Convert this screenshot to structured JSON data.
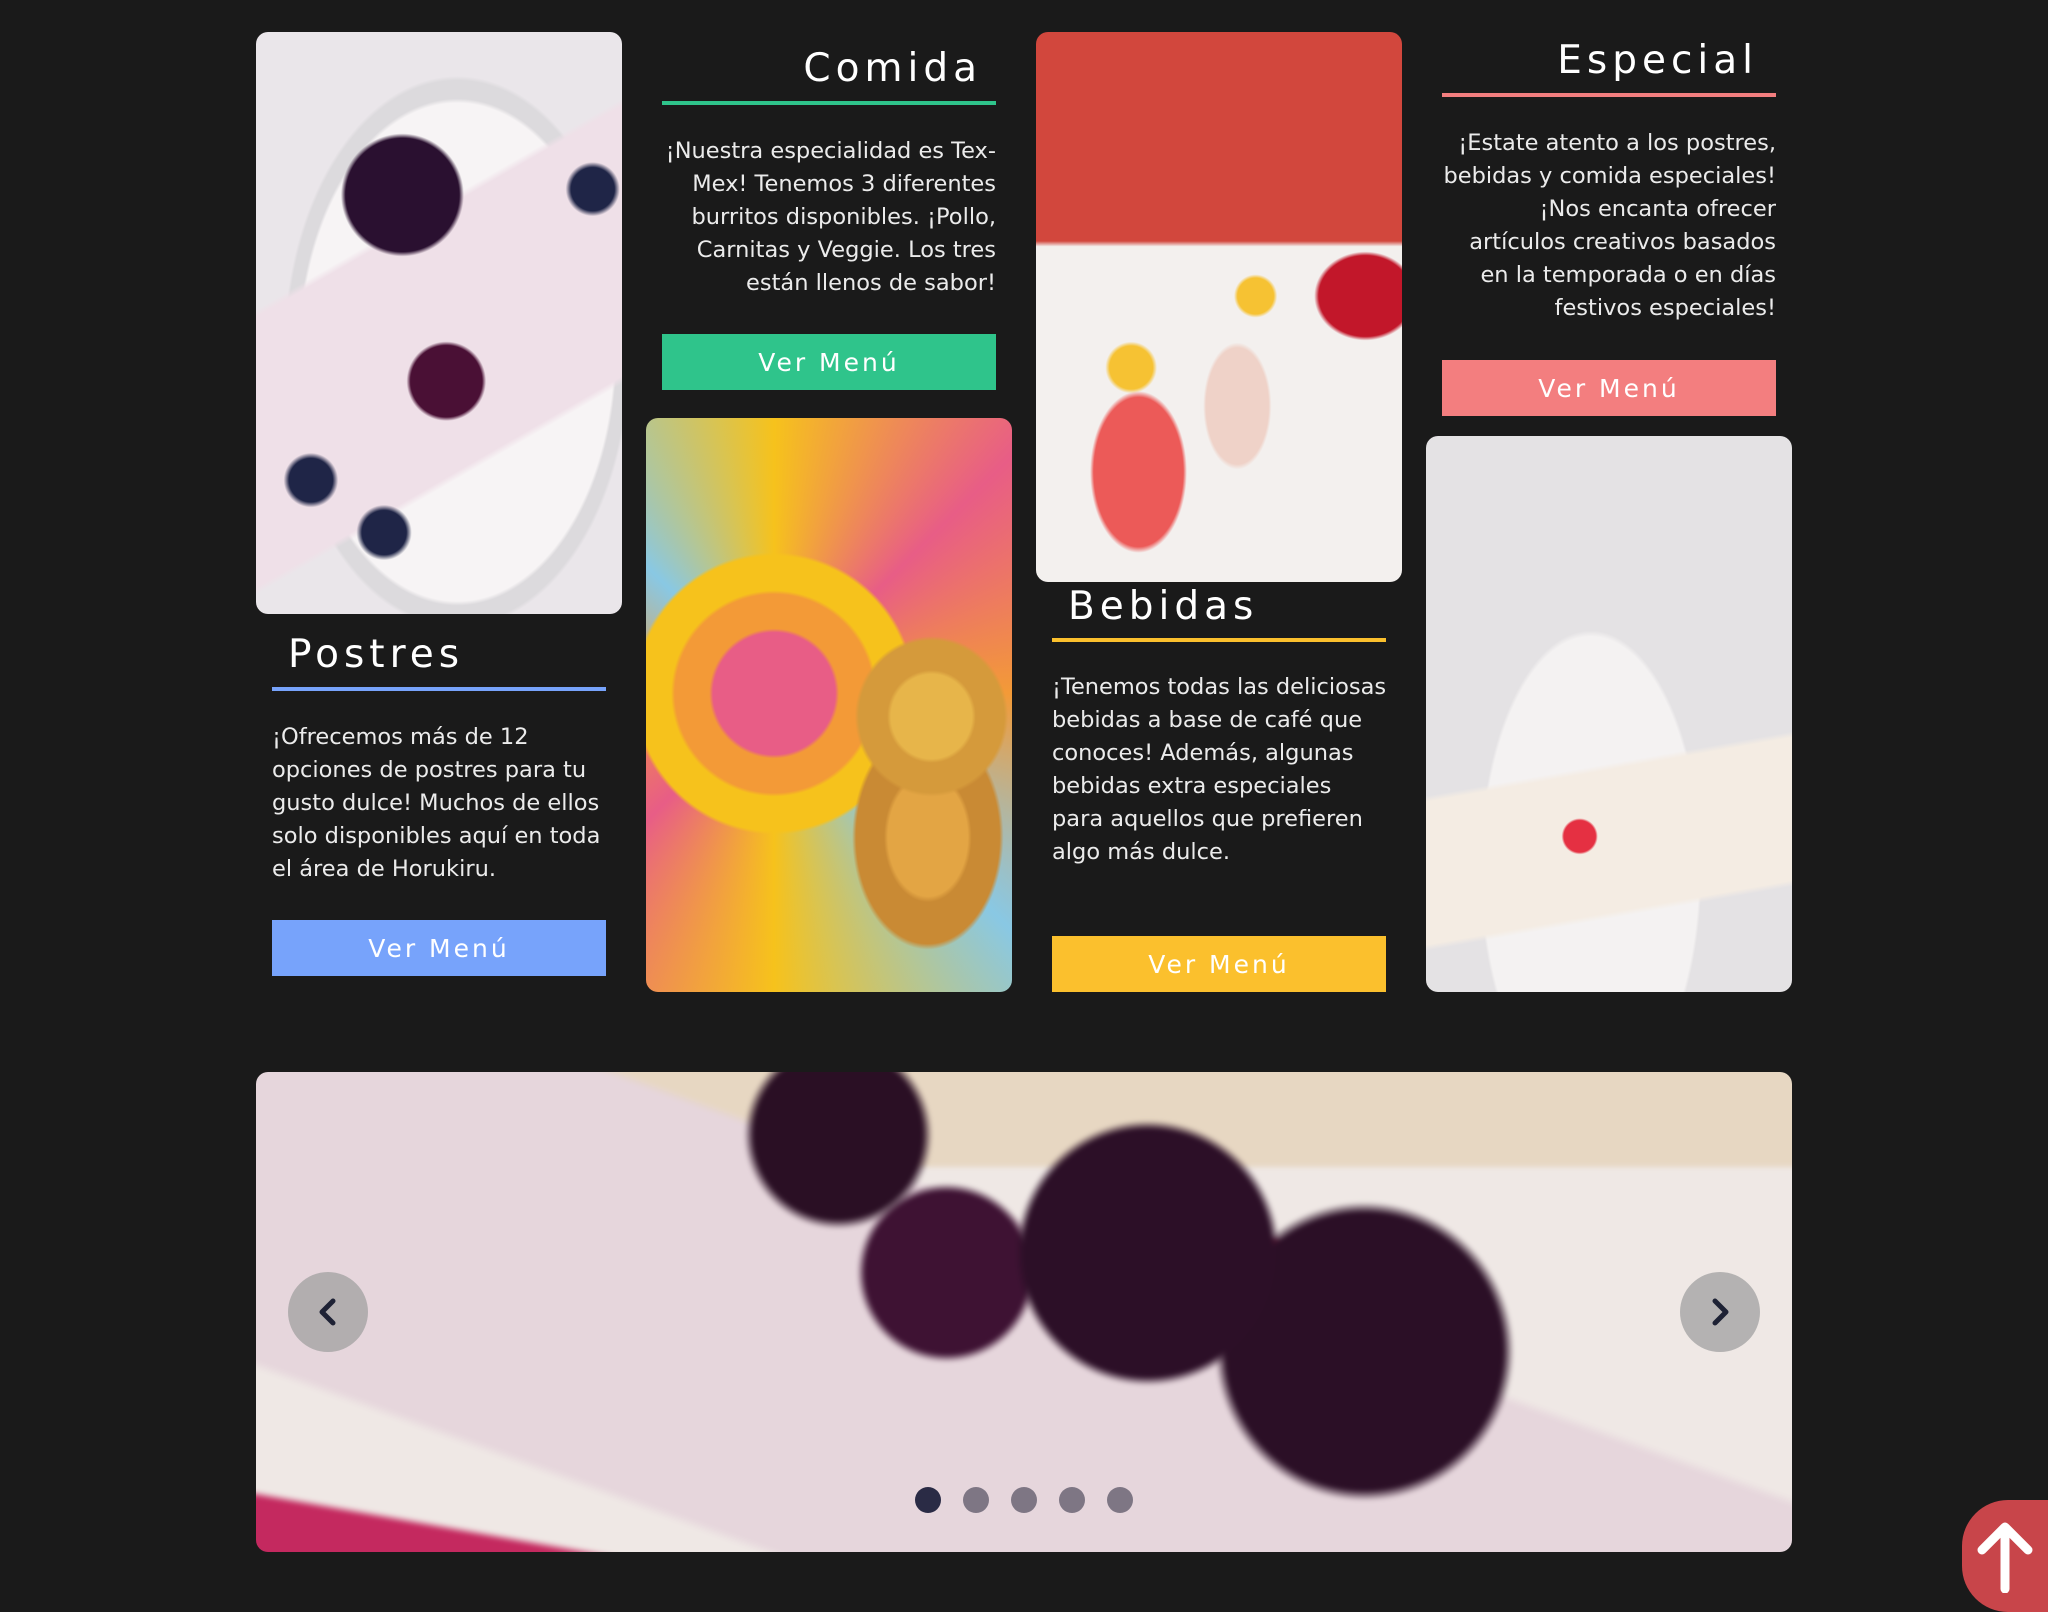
{
  "sections": {
    "postres": {
      "title": "Postres",
      "text": "¡Ofrecemos más de 12 opciones de postres para tu gusto dulce! Muchos de ellos solo disponibles aquí en toda el área de Horukiru.",
      "button": "Ver Menú",
      "color": "#77a3fb"
    },
    "comida": {
      "title": "Comida",
      "text": "¡Nuestra especialidad es Tex-Mex! Tenemos 3 diferentes burritos disponibles. ¡Pollo, Carnitas y Veggie. Los tres están llenos de sabor!",
      "button": "Ver Menú",
      "color": "#2fc48b"
    },
    "bebidas": {
      "title": "Bebidas",
      "text": "¡Tenemos todas las deliciosas bebidas a base de café que conoces! Además, algunas bebidas extra especiales para aquellos que prefieren algo más dulce.",
      "button": "Ver Menú",
      "color": "#fbc02d"
    },
    "especial": {
      "title": "Especial",
      "text": "¡Estate atento a los postres, bebidas y comida especiales! ¡Nos encanta ofrecer artículos creativos basados en la temporada o en días festivos especiales!",
      "button": "Ver Menú",
      "color": "#f37e7f"
    }
  },
  "carousel": {
    "active_index": 0,
    "slide_count": 5,
    "icons": {
      "prev": "chevron-left-icon",
      "next": "chevron-right-icon"
    }
  },
  "scroll_top": {
    "icon": "arrow-up-icon",
    "color": "#c8454a"
  },
  "colors": {
    "background": "#1a1a1a",
    "text": "#ffffff"
  }
}
